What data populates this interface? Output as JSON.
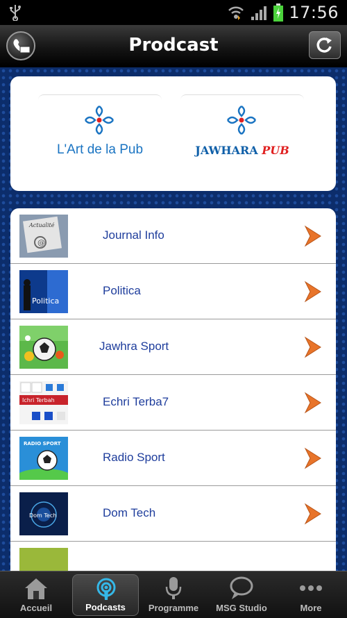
{
  "statusbar": {
    "time": "17:56"
  },
  "header": {
    "title": "Prodcast"
  },
  "logos": [
    {
      "text": "L'Art de la Pub"
    },
    {
      "text_main": "JAWHARA ",
      "text_accent": "PUB"
    }
  ],
  "podcasts": [
    {
      "label": "Journal Info",
      "thumb_text": "Actualité"
    },
    {
      "label": "Politica",
      "thumb_text": "Politica"
    },
    {
      "label": "Jawhra Sport",
      "thumb_text": ""
    },
    {
      "label": "Echri Terba7",
      "thumb_text": "Ichri Terbah"
    },
    {
      "label": "Radio Sport",
      "thumb_text": "RADIO SPORT"
    },
    {
      "label": "Dom Tech",
      "thumb_text": "Dom Tech"
    }
  ],
  "tabs": [
    {
      "label": "Accueil",
      "icon": "home-icon"
    },
    {
      "label": "Podcasts",
      "icon": "podcast-icon",
      "active": true
    },
    {
      "label": "Programme",
      "icon": "microphone-icon"
    },
    {
      "label": "MSG Studio",
      "icon": "chat-bubble-icon"
    },
    {
      "label": "More",
      "icon": "more-dots-icon"
    }
  ],
  "colors": {
    "accent_blue": "#1e3d9c",
    "chevron_orange": "#e8742a",
    "background": "#0c2d6b"
  }
}
